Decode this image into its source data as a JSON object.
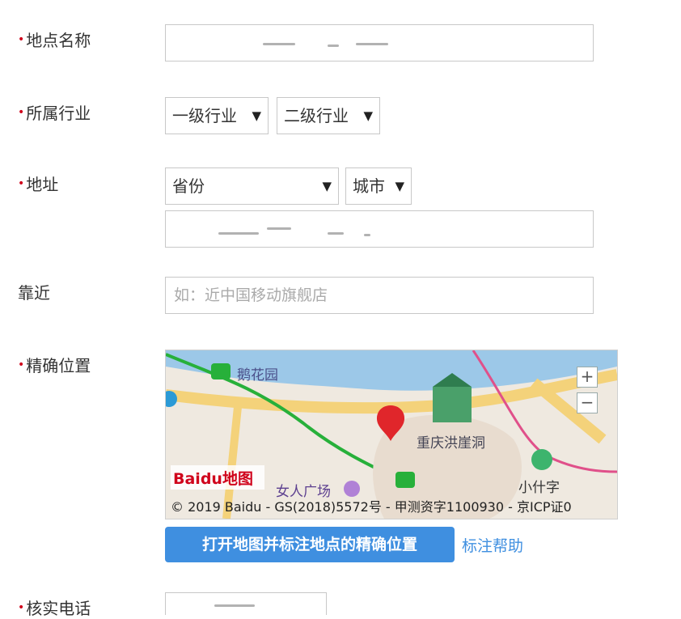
{
  "form": {
    "location_name": {
      "label": "地点名称",
      "value": ""
    },
    "industry": {
      "label": "所属行业",
      "level1": "一级行业",
      "level2": "二级行业"
    },
    "address": {
      "label": "地址",
      "province": "省份",
      "city": "城市",
      "detail": ""
    },
    "nearby": {
      "label": "靠近",
      "placeholder": "如：近中国移动旗舰店"
    },
    "precise_location": {
      "label": "精确位置"
    },
    "phone": {
      "label": "核实电话",
      "value": ""
    }
  },
  "map": {
    "labels": {
      "park": "鹅花园",
      "landmark": "重庆洪崖洞",
      "plaza": "女人广场",
      "station": "小什字"
    },
    "logo_text": "Baidu地图",
    "copyright": "© 2019 Baidu - GS(2018)5572号 - 甲测资字1100930 - 京ICP证0",
    "zoom_in": "+",
    "zoom_out": "−"
  },
  "actions": {
    "open_map_button": "打开地图并标注地点的精确位置",
    "help_link": "标注帮助"
  },
  "arrow_glyph": "▼",
  "colors": {
    "required": "#d0021b",
    "primary": "#3f8fe0",
    "link": "#3f8fe0"
  }
}
